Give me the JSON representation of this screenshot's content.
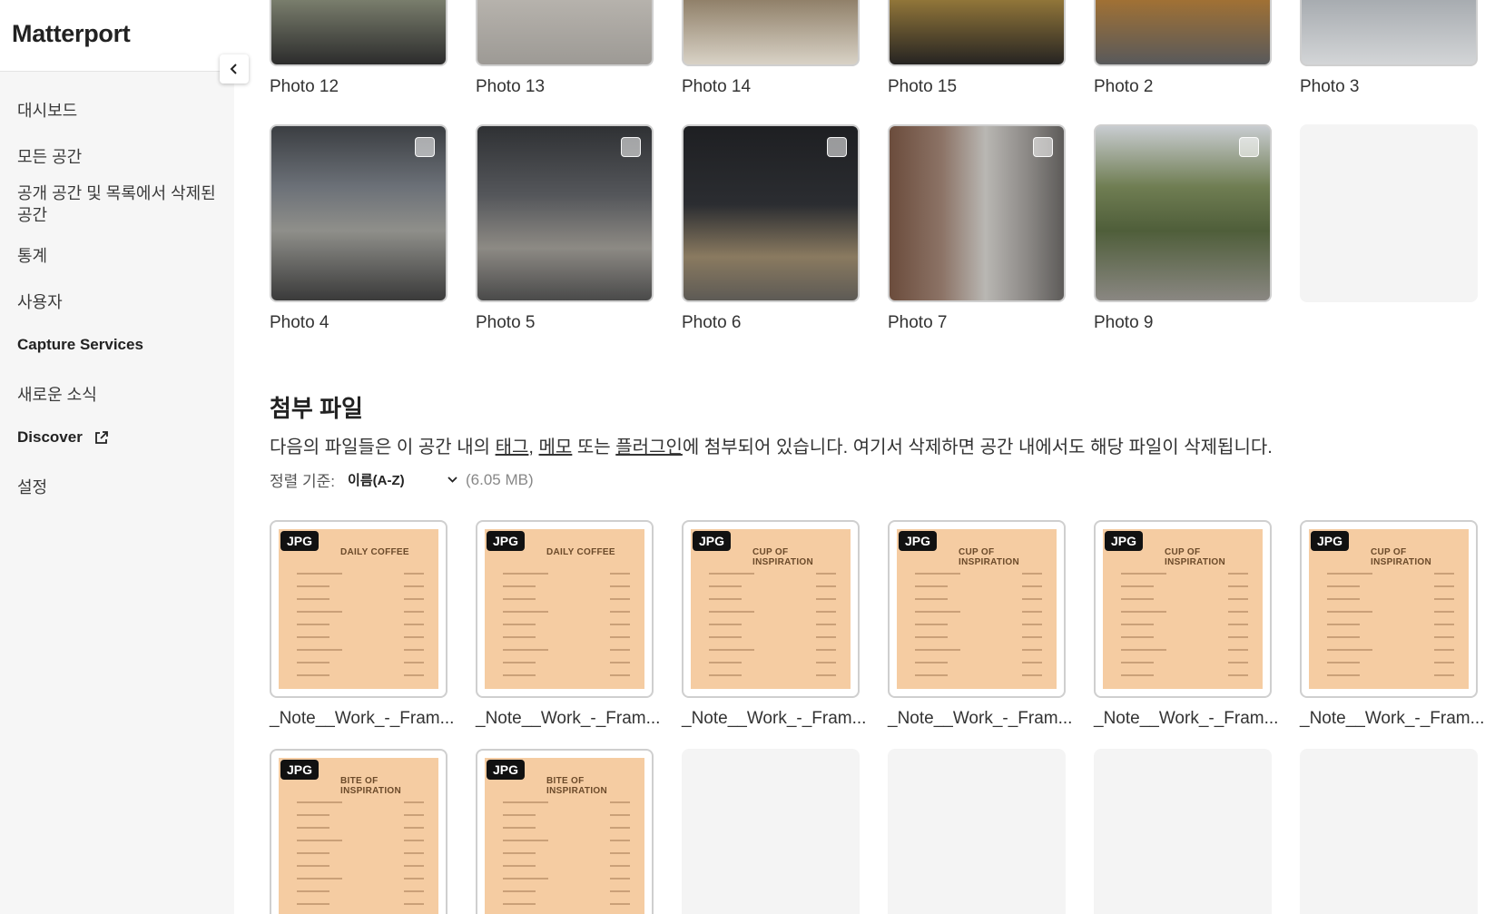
{
  "app": {
    "logo": "Matterport"
  },
  "sidebar": {
    "items": [
      {
        "label": "대시보드"
      },
      {
        "label": "모든 공간"
      },
      {
        "label": "공개 공간 및 목록에서 삭제된 공간"
      },
      {
        "label": "통계"
      },
      {
        "label": "사용자"
      },
      {
        "label": "Capture Services"
      },
      {
        "label": "새로운 소식"
      },
      {
        "label": "Discover"
      },
      {
        "label": "설정"
      }
    ]
  },
  "photos": {
    "row1": [
      "Photo 12",
      "Photo 13",
      "Photo 14",
      "Photo 15",
      "Photo 2",
      "Photo 3"
    ],
    "row2": [
      "Photo 4",
      "Photo 5",
      "Photo 6",
      "Photo 7",
      "Photo 9"
    ]
  },
  "attachments": {
    "title": "첨부 파일",
    "desc_before": "다음의 파일들은 이 공간 내의 ",
    "link_tag": "태그",
    "comma": ", ",
    "link_memo": "메모",
    "or": " 또는 ",
    "link_plugin": "플러그인",
    "desc_after": "에 첨부되어 있습니다. 여기서 삭제하면 공간 내에서도 해당 파일이 삭제됩니다.",
    "sort_label": "정렬 기준:",
    "sort_value": "이름(A-Z)",
    "total_size": "(6.05 MB)",
    "badge": "JPG",
    "files": [
      {
        "name": "_Note__Work_-_Fram...",
        "title": "DAILY COFFEE"
      },
      {
        "name": "_Note__Work_-_Fram...",
        "title": "DAILY COFFEE"
      },
      {
        "name": "_Note__Work_-_Fram...",
        "title": "CUP OF INSPIRATION"
      },
      {
        "name": "_Note__Work_-_Fram...",
        "title": "CUP OF INSPIRATION"
      },
      {
        "name": "_Note__Work_-_Fram...",
        "title": "CUP OF INSPIRATION"
      },
      {
        "name": "_Note__Work_-_Fram...",
        "title": "CUP OF INSPIRATION"
      },
      {
        "name": "",
        "title": "BITE OF INSPIRATION"
      },
      {
        "name": "",
        "title": "BITE OF INSPIRATION"
      }
    ]
  }
}
